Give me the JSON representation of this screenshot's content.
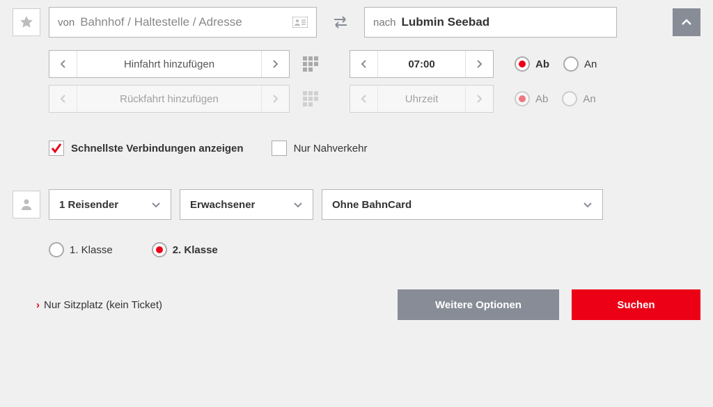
{
  "from": {
    "prefix": "von",
    "placeholder": "Bahnhof / Haltestelle / Adresse",
    "value": ""
  },
  "to": {
    "prefix": "nach",
    "value": "Lubmin Seebad"
  },
  "outbound": {
    "date_label": "Hinfahrt hinzufügen",
    "time": "07:00"
  },
  "return": {
    "date_label": "Rückfahrt hinzufügen",
    "time_placeholder": "Uhrzeit"
  },
  "depart_arrive": {
    "ab": "Ab",
    "an": "An"
  },
  "checks": {
    "fastest": "Schnellste Verbindungen anzeigen",
    "local": "Nur Nahverkehr"
  },
  "travelers": {
    "count": "1 Reisender",
    "type": "Erwachsener",
    "bahncard": "Ohne BahnCard"
  },
  "class_options": {
    "first": "1. Klasse",
    "second": "2. Klasse"
  },
  "seat_only": "Nur Sitzplatz (kein Ticket)",
  "buttons": {
    "more": "Weitere Optionen",
    "search": "Suchen"
  }
}
